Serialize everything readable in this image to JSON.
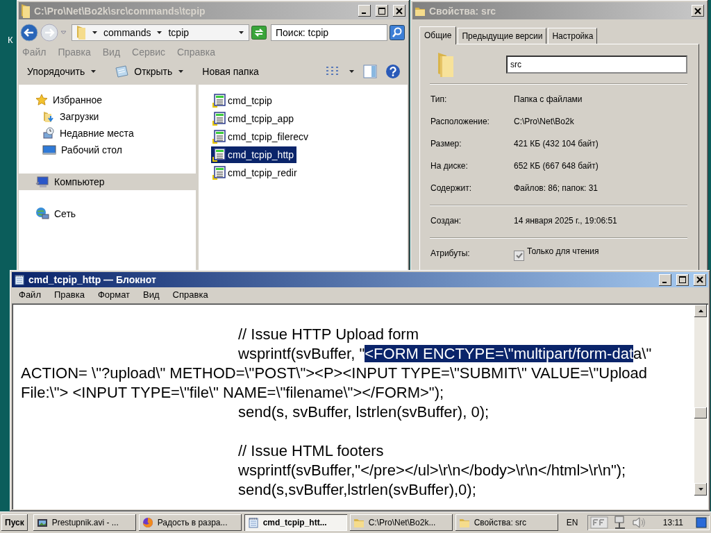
{
  "desktop": {
    "icon_label": "К"
  },
  "explorer": {
    "title": "C:\\Pro\\Net\\Bo2k\\src\\commands\\tcpip",
    "active": false,
    "breadcrumb": [
      "commands",
      "tcpip"
    ],
    "search": {
      "placeholder": "Поиск: tcpip"
    },
    "menu": [
      "Файл",
      "Правка",
      "Вид",
      "Сервис",
      "Справка"
    ],
    "toolbar": [
      {
        "label": "Упорядочить",
        "kind": "dropdown"
      },
      {
        "label": "Открыть",
        "kind": "open"
      },
      {
        "label": "Новая папка",
        "kind": "plain"
      }
    ],
    "nav": [
      {
        "label": "Избранное",
        "kind": "star",
        "selected": false,
        "children": [
          {
            "label": "Загрузки",
            "kind": "downloads",
            "selected": false
          },
          {
            "label": "Недавние места",
            "kind": "recent",
            "selected": false
          },
          {
            "label": "Рабочий стол",
            "kind": "desktop",
            "selected": false
          }
        ]
      },
      {
        "label": "Компьютер",
        "kind": "computer",
        "selected": true
      },
      {
        "label": "Сеть",
        "kind": "network",
        "selected": false
      }
    ],
    "files": [
      {
        "name": "cmd_tcpip",
        "selected": false
      },
      {
        "name": "cmd_tcpip_app",
        "selected": false
      },
      {
        "name": "cmd_tcpip_filerecv",
        "selected": false
      },
      {
        "name": "cmd_tcpip_http",
        "selected": true
      },
      {
        "name": "cmd_tcpip_redir",
        "selected": false
      }
    ]
  },
  "properties": {
    "title": "Свойства: src",
    "active": false,
    "tabs": [
      {
        "label": "Общие",
        "selected": true
      },
      {
        "label": "Предыдущие версии",
        "selected": false
      },
      {
        "label": "Настройка",
        "selected": false
      }
    ],
    "name_field": {
      "value": "src"
    },
    "groups": [
      [
        {
          "label": "Тип:",
          "value": "Папка с файлами"
        },
        {
          "label": "Расположение:",
          "value": "C:\\Pro\\Net\\Bo2k"
        },
        {
          "label": "Размер:",
          "value": "421 КБ (432 104 байт)"
        },
        {
          "label": "На диске:",
          "value": "652 КБ (667 648 байт)"
        },
        {
          "label": "Содержит:",
          "value": "Файлов: 86; папок: 31"
        }
      ],
      [
        {
          "label": "Создан:",
          "value": "14 января 2025 г., 19:06:51"
        }
      ]
    ],
    "attributes": {
      "label": "Атрибуты:",
      "checkbox": {
        "label": "Только для чтения",
        "checked": true
      }
    }
  },
  "notepad": {
    "title": "cmd_tcpip_http — Блокнот",
    "active": true,
    "menu": [
      "Файл",
      "Правка",
      "Формат",
      "Вид",
      "Справка"
    ],
    "lines": [
      {
        "indent": true,
        "text": "// Issue HTTP Upload form"
      },
      {
        "indent": true,
        "before": "wsprintf(svBuffer, \"",
        "selected_text": "<FORM ENCTYPE=\\\"multipart/form-dat",
        "after": "a\\\""
      },
      {
        "indent": false,
        "text": "ACTION= \\\"?upload\\\" METHOD=\\\"POST\\\"><P><INPUT TYPE=\\\"SUBMIT\\\" VALUE=\\\"Upload"
      },
      {
        "indent": false,
        "text": "File:\\\"> <INPUT TYPE=\\\"file\\\" NAME=\\\"filename\\\"></FORM>\");"
      },
      {
        "indent": true,
        "text": "send(s, svBuffer, lstrlen(svBuffer), 0);"
      },
      {
        "indent": true,
        "blank_before": true,
        "text": "// Issue HTML footers"
      },
      {
        "indent": true,
        "text": "wsprintf(svBuffer,\"</pre></ul>\\r\\n</body>\\r\\n</html>\\r\\n\");"
      },
      {
        "indent": true,
        "text": "send(s,svBuffer,lstrlen(svBuffer),0);"
      }
    ]
  },
  "taskbar": {
    "start": "Пуск",
    "tasks": [
      {
        "label": "Prestupnik.avi - ...",
        "kind": "video",
        "selected": false
      },
      {
        "label": "Радость в разра...",
        "kind": "browser",
        "selected": false
      },
      {
        "label": "cmd_tcpip_htt...",
        "kind": "notepad",
        "selected": true
      },
      {
        "label": "C:\\Pro\\Net\\Bo2k...",
        "kind": "folder",
        "selected": false
      },
      {
        "label": "Свойства: src",
        "kind": "folder",
        "selected": false
      }
    ],
    "language": "EN",
    "clock": "13:11"
  }
}
